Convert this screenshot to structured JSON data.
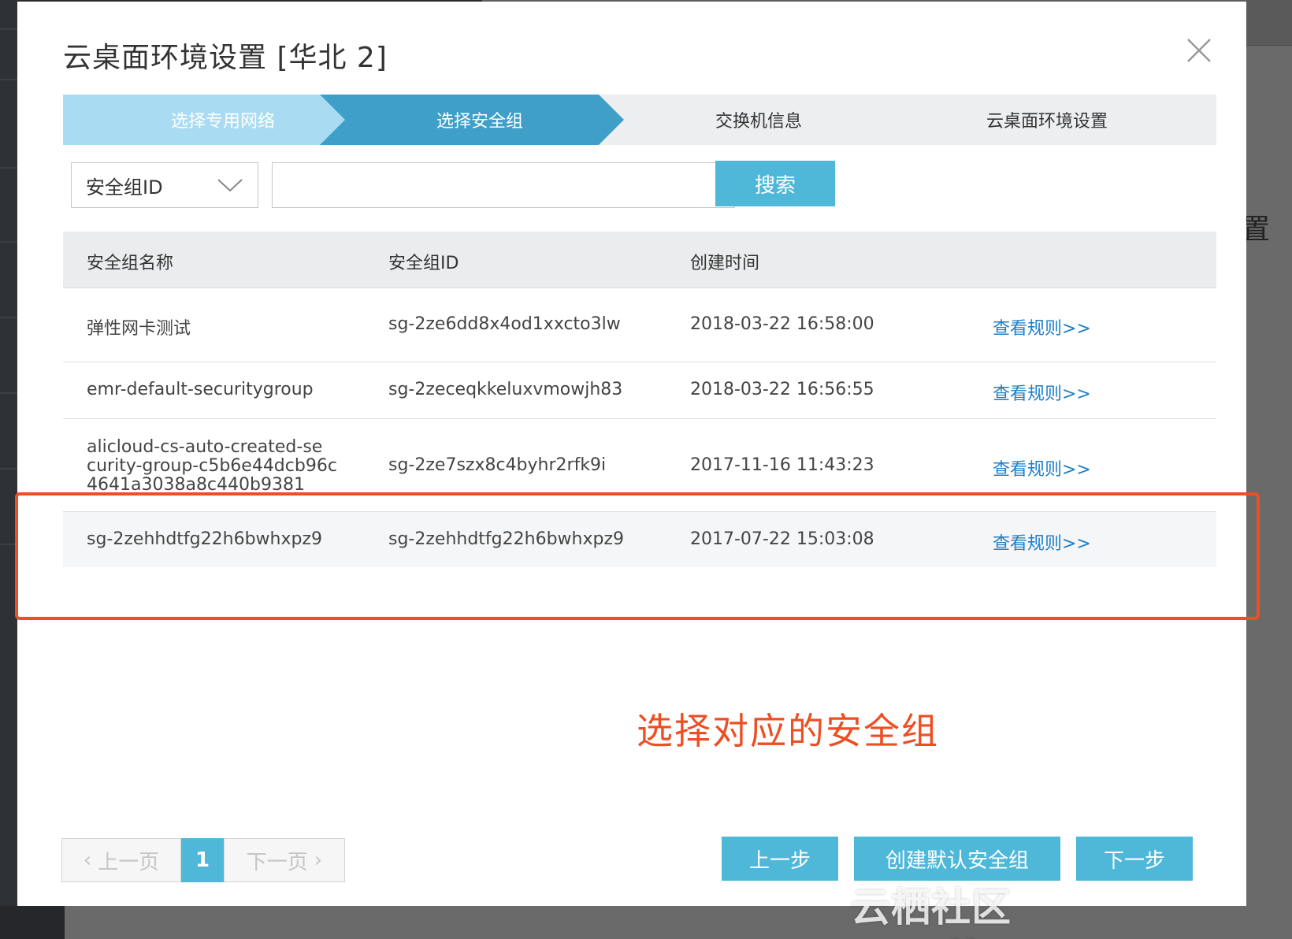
{
  "dialog": {
    "title": "云桌面环境设置 [华北 2]"
  },
  "steps": [
    {
      "label": "选择专用网络",
      "state": "done"
    },
    {
      "label": "选择安全组",
      "state": "active"
    },
    {
      "label": "交换机信息",
      "state": "pending"
    },
    {
      "label": "云桌面环境设置",
      "state": "pending"
    }
  ],
  "search": {
    "filter_value": "安全组ID",
    "input_value": "",
    "button_label": "搜索"
  },
  "table": {
    "headers": [
      "安全组名称",
      "安全组ID",
      "创建时间"
    ],
    "rows": [
      {
        "name": "弹性网卡测试",
        "id": "sg-2ze6dd8x4od1xxcto3lw",
        "created": "2018-03-22 16:58:00",
        "action": "查看规则>>"
      },
      {
        "name": "emr-default-securitygroup",
        "id": "sg-2zeceqkkeluxvmowjh83",
        "created": "2018-03-22 16:56:55",
        "action": "查看规则>>"
      },
      {
        "name_lines": [
          "alicloud-cs-auto-created-se",
          "curity-group-c5b6e44dcb96c",
          "4641a3038a8c440b9381"
        ],
        "id": "sg-2ze7szx8c4byhr2rfk9i",
        "created": "2017-11-16 11:43:23",
        "action": "查看规则>>"
      },
      {
        "name": "sg-2zehhdtfg22h6bwhxpz9",
        "id": "sg-2zehhdtfg22h6bwhxpz9",
        "created": "2017-07-22 15:03:08",
        "action": "查看规则>>"
      }
    ]
  },
  "annotation": "选择对应的安全组",
  "pagination": {
    "prev_label": "上一页",
    "current": "1",
    "next_label": "下一页"
  },
  "footer": {
    "prev_step": "上一步",
    "create_default": "创建默认安全组",
    "next_step": "下一步"
  },
  "background": {
    "peek_text": "置"
  },
  "watermark": "云栖社区 yq.aliyun.com",
  "colors": {
    "accent": "#4fb8d9",
    "step_done": "#a9dcf2",
    "step_active": "#3f9fc9",
    "step_pending": "#edeef0",
    "annotation": "#ec4f24",
    "link": "#1d7fc8"
  }
}
